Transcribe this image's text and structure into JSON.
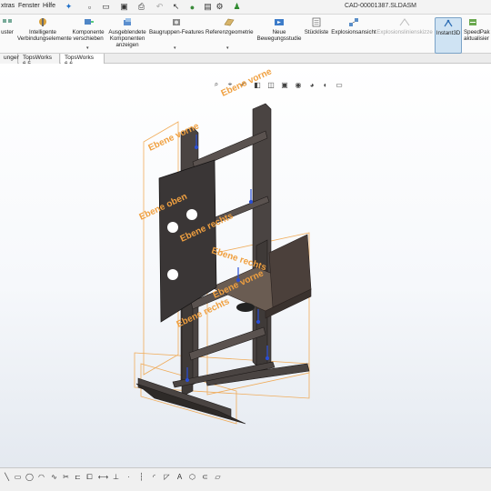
{
  "menu": {
    "items": [
      "xtras",
      "Fenster",
      "Hilfe"
    ]
  },
  "document_title": "CAD-00001387.SLDASM",
  "ribbon": {
    "commands": [
      {
        "id": "muster",
        "label": "uster"
      },
      {
        "id": "smart-mates",
        "label": "Intelligente\nVerbindungselemente"
      },
      {
        "id": "move-component",
        "label": "Komponente\nverschieben"
      },
      {
        "id": "hidden-components",
        "label": "Ausgeblendete\nKomponenten\nanzeigen"
      },
      {
        "id": "assembly-features",
        "label": "Baugruppen-Features"
      },
      {
        "id": "reference-geometry",
        "label": "Referenzgeometrie"
      },
      {
        "id": "new-motion-study",
        "label": "Neue\nBewegungsstudie"
      },
      {
        "id": "bom",
        "label": "Stückliste"
      },
      {
        "id": "exploded-view",
        "label": "Explosionsansicht"
      },
      {
        "id": "explode-line-sketch",
        "label": "Explosionslinienskizze"
      },
      {
        "id": "instant3d",
        "label": "Instant3D"
      },
      {
        "id": "speedpak",
        "label": "SpeedPak\naktualisier"
      }
    ]
  },
  "tabs": [
    {
      "label": "ungen"
    },
    {
      "label": "TopsWorks 6.5"
    },
    {
      "label": "TopsWorks 6.6"
    }
  ],
  "viewport": {
    "plane_labels": {
      "top": "Ebene vorne",
      "upper_left": "Ebene vorne",
      "left_mid": "Ebene oben",
      "center": "Ebene rechts",
      "right_top": "Ebene rechts",
      "right_mid": "Ebene vorne",
      "lower": "Ebene rechts"
    }
  },
  "colors": {
    "accent_orange": "#f0a040",
    "plate_dark": "#3a3636",
    "frame_dark": "#4a4442",
    "axis_blue": "#2a4fd6"
  }
}
